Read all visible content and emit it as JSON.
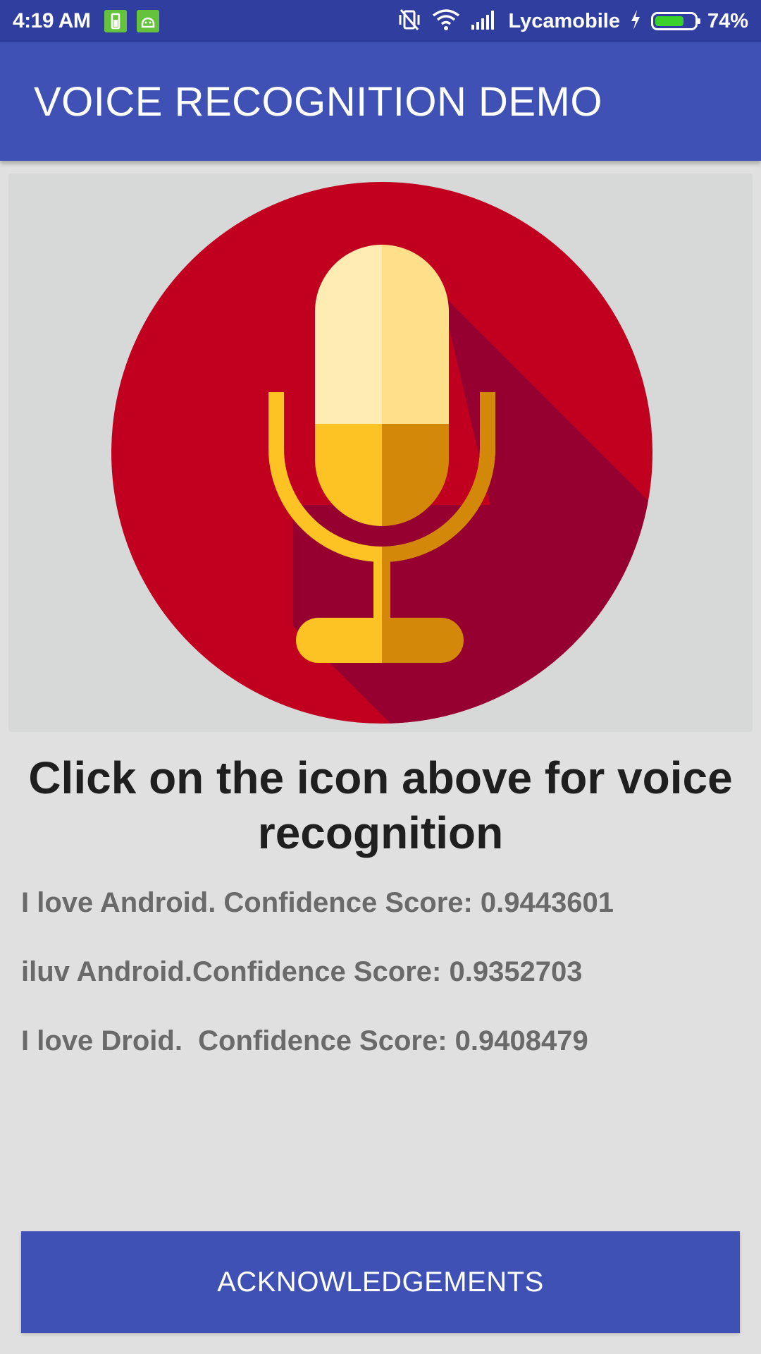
{
  "status_bar": {
    "time": "4:19 AM",
    "carrier": "Lycamobile",
    "battery_percent": "74%",
    "battery_level": 0.74,
    "icons": [
      "battery-notification-icon",
      "android-notification-icon",
      "vibrate-off-icon",
      "wifi-icon",
      "signal-icon",
      "charging-icon",
      "battery-icon"
    ]
  },
  "app_bar": {
    "title": "VOICE RECOGNITION DEMO"
  },
  "main": {
    "mic_icon": "microphone-icon",
    "prompt": "Click on the icon above for voice recognition",
    "results": [
      "I love Android. Confidence Score: 0.9443601",
      "iluv Android.Confidence Score: 0.9352703",
      "I love Droid.  Confidence Score: 0.9408479"
    ]
  },
  "footer": {
    "button_label": "ACKNOWLEDGEMENTS"
  },
  "colors": {
    "status_bar": "#303f9f",
    "app_bar": "#3f51b5",
    "mic_circle": "#c0001e",
    "mic_shadow": "#950030",
    "mic_gold": "#fdc325",
    "mic_gold_dark": "#d4880a"
  }
}
